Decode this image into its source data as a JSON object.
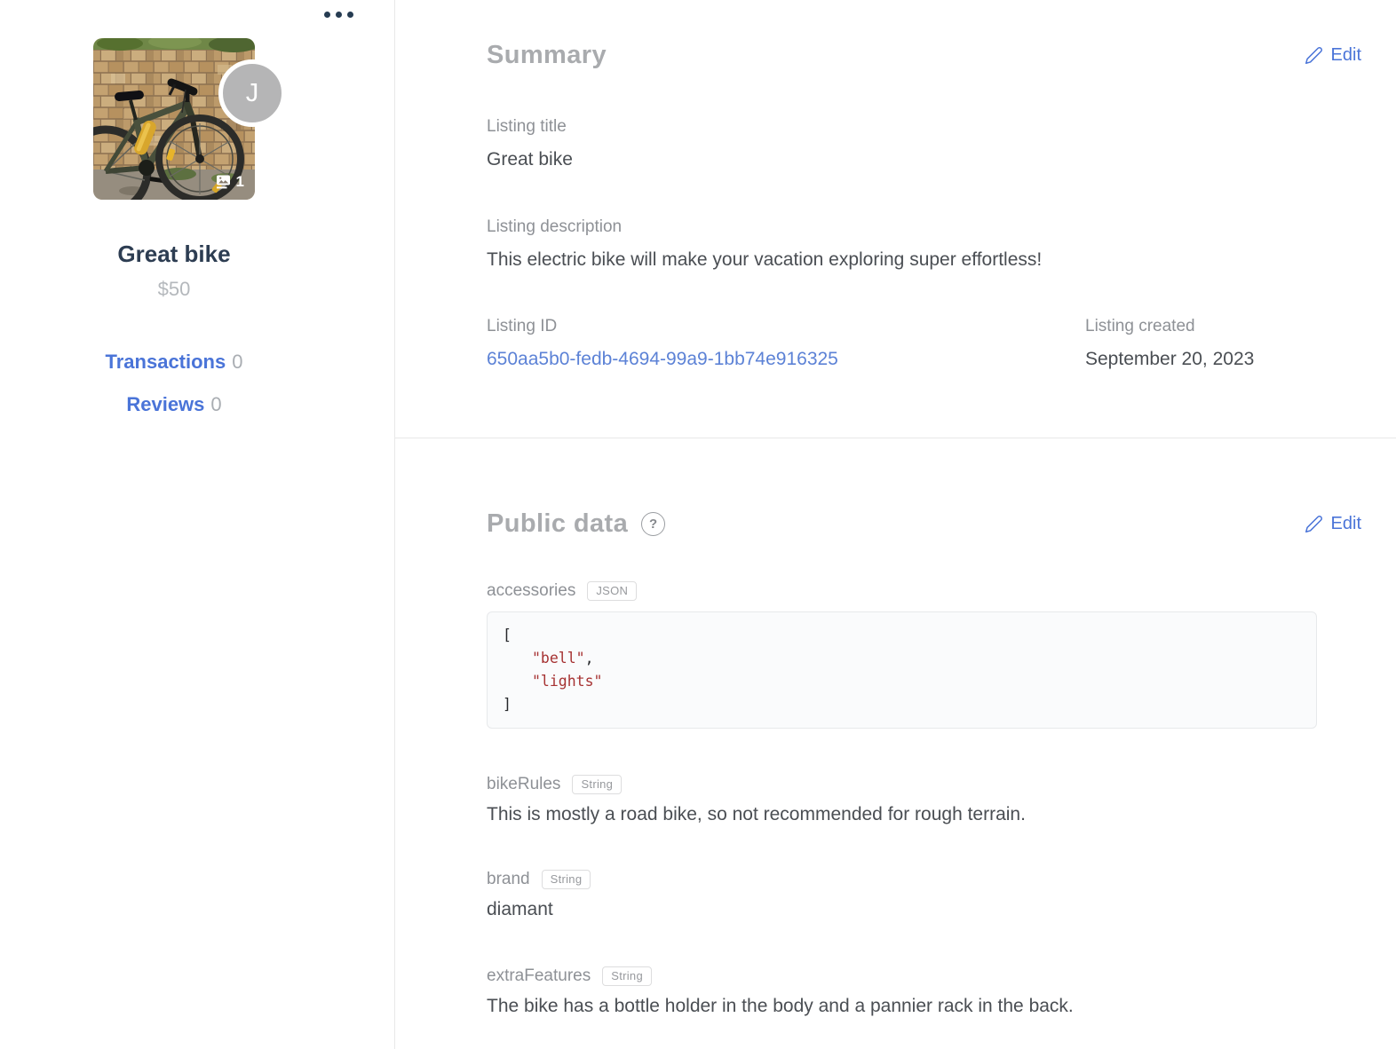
{
  "sidebar": {
    "avatar_initial": "J",
    "photo_count": "1",
    "title": "Great bike",
    "price": "$50",
    "transactions": {
      "label": "Transactions",
      "count": "0"
    },
    "reviews": {
      "label": "Reviews",
      "count": "0"
    }
  },
  "summary": {
    "heading": "Summary",
    "edit_label": "Edit",
    "listing_title": {
      "label": "Listing title",
      "value": "Great bike"
    },
    "listing_description": {
      "label": "Listing description",
      "value": "This electric bike will make your vacation exploring super effortless!"
    },
    "listing_id": {
      "label": "Listing ID",
      "value": "650aa5b0-fedb-4694-99a9-1bb74e916325"
    },
    "listing_created": {
      "label": "Listing created",
      "value": "September 20, 2023"
    }
  },
  "public_data": {
    "heading": "Public data",
    "help_icon": "?",
    "edit_label": "Edit",
    "accessories": {
      "key": "accessories",
      "type_badge": "JSON",
      "code": {
        "open_bracket": "[",
        "item1": "\"bell\"",
        "comma": ",",
        "item2": "\"lights\"",
        "close_bracket": "]"
      }
    },
    "bike_rules": {
      "key": "bikeRules",
      "type_badge": "String",
      "value": "This is mostly a road bike, so not recommended for rough terrain."
    },
    "brand": {
      "key": "brand",
      "type_badge": "String",
      "value": "diamant"
    },
    "extra_features": {
      "key": "extraFeatures",
      "type_badge": "String",
      "value": "The bike has a bottle holder in the body and a pannier rack in the back."
    }
  },
  "colors": {
    "accent_blue": "#4a74d8",
    "id_link_blue": "#5c82d6",
    "heading_gray": "#a9abae",
    "label_gray": "#8e9196",
    "value_dark": "#4a4e53",
    "navy_text": "#2d3d52",
    "code_string_red": "#a63232",
    "divider_gray": "#e8e8e8"
  }
}
